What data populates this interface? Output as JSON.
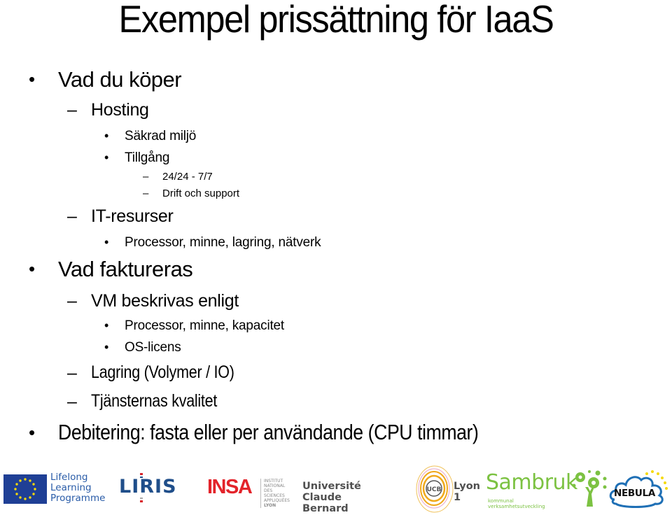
{
  "slide": {
    "title": "Exempel prissättning för IaaS",
    "bullet_glyph": "•",
    "dash_glyph": "–",
    "items": [
      {
        "level": 1,
        "text": "Vad du köper"
      },
      {
        "level": 2,
        "text": "Hosting"
      },
      {
        "level": 3,
        "text": "Säkrad miljö"
      },
      {
        "level": 3,
        "text": "Tillgång"
      },
      {
        "level": 4,
        "text": "24/24 - 7/7"
      },
      {
        "level": 4,
        "text": "Drift och support"
      },
      {
        "level": 2,
        "text": "IT-resurser"
      },
      {
        "level": 3,
        "text": "Processor, minne, lagring, nätverk"
      },
      {
        "level": 1,
        "text": "Vad faktureras"
      },
      {
        "level": 2,
        "text": "VM beskrivas enligt"
      },
      {
        "level": 3,
        "text": "Processor, minne, kapacitet"
      },
      {
        "level": 3,
        "text": "OS-licens"
      },
      {
        "level": 2,
        "text": "Lagring (Volymer / IO)"
      },
      {
        "level": 2,
        "text": "Tjänsternas kvalitet"
      },
      {
        "level": 1,
        "text": "Debitering: fasta eller per användande (CPU timmar)"
      }
    ]
  },
  "footer": {
    "logos": {
      "llp": {
        "lines": [
          "Lifelong",
          "Learning",
          "Programme"
        ],
        "color": "#2a5ca8",
        "flag_color": "#1f3f95",
        "star_color": "#f5d90a"
      },
      "liris": {
        "text": "LIRIS",
        "color": "#1f4e8a",
        "accent": "#d9262c"
      },
      "insa": {
        "text": "INSA",
        "sub_lines": [
          "INSTITUT NATIONAL",
          "DES SCIENCES",
          "APPLIQUÉES",
          "LYON"
        ],
        "color": "#e3232a"
      },
      "ucb": {
        "text": "Université Claude Bernard",
        "suffix": "Lyon 1",
        "emblem": "UCB",
        "color": "#505050",
        "ring_color": "#f0a91c"
      },
      "sambruk": {
        "text": "Sambruk",
        "sub": "kommunal verksamhetsutveckling",
        "color": "#7cc242"
      },
      "nebula": {
        "text": "NEBULA",
        "cloud_color": "#1e6fb5",
        "star_color": "#f5d90a"
      }
    }
  }
}
